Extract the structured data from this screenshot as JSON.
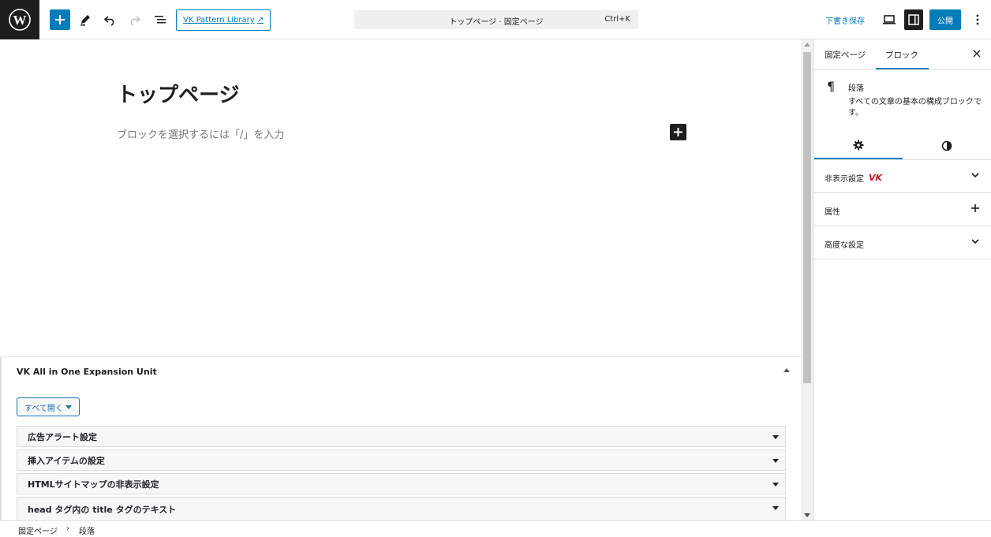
{
  "topbar": {
    "vk_button_label": "VK Pattern Library",
    "vk_button_ext": "↗",
    "command_title": "トップページ · 固定ページ",
    "command_shortcut": "Ctrl+K",
    "save_draft_label": "下書き保存",
    "publish_label": "公開"
  },
  "editor": {
    "post_title": "トップページ",
    "placeholder": "ブロックを選択するには「/」を入力"
  },
  "metabox": {
    "title": "VK All in One Expansion Unit",
    "expand_all_label": "すべて開く",
    "rows": [
      "広告アラート設定",
      "挿入アイテムの設定",
      "HTMLサイトマップの非表示設定",
      "head タグ内の title タグのテキスト"
    ]
  },
  "footer": {
    "crumb_page": "固定ページ",
    "crumb_sep": "›",
    "crumb_block": "段落"
  },
  "sidebar": {
    "tab_page": "固定ページ",
    "tab_block": "ブロック",
    "close_glyph": "×",
    "block_icon": "¶",
    "block_name": "段落",
    "block_description": "すべての文章の基本の構成ブロックです。",
    "panels": {
      "hide_settings": "非表示設定",
      "vk_mark": "VK",
      "attributes": "属性",
      "advanced": "高度な設定"
    }
  },
  "colors": {
    "accent": "#007cba",
    "dark": "#1e1e1e",
    "vk_red": "#c4161c"
  }
}
